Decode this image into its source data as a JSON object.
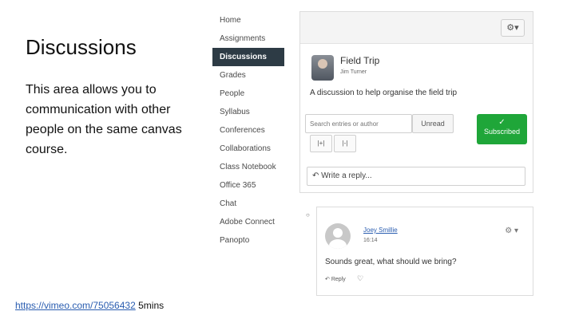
{
  "slide": {
    "title": "Discussions",
    "body": "This area allows you to communication with other people on the same canvas course.",
    "link_text": "https://vimeo.com/75056432",
    "duration": "5mins"
  },
  "nav": {
    "items": [
      {
        "label": "Home"
      },
      {
        "label": "Assignments"
      },
      {
        "label": "Discussions",
        "active": true
      },
      {
        "label": "Grades"
      },
      {
        "label": "People"
      },
      {
        "label": "Syllabus"
      },
      {
        "label": "Conferences"
      },
      {
        "label": "Collaborations"
      },
      {
        "label": "Class Notebook"
      },
      {
        "label": "Office 365"
      },
      {
        "label": "Chat"
      },
      {
        "label": "Adobe Connect"
      },
      {
        "label": "Panopto"
      }
    ]
  },
  "discussion": {
    "settings_icon": "gear-icon",
    "title": "Field Trip",
    "author": "Jim Turner",
    "description": "A discussion to help organise the field trip",
    "search_placeholder": "Search entries or author",
    "unread_label": "Unread",
    "expand_label": "|+|",
    "collapse_label": "|-|",
    "subscribed_label": "Subscribed",
    "reply_placeholder": "Write a reply..."
  },
  "entry": {
    "author": "Joey Smillie",
    "time": "16:14",
    "text": "Sounds great, what should we bring?",
    "reply_label": "Reply"
  },
  "colors": {
    "nav_active": "#2d3b45",
    "subscribed": "#1fa639",
    "link": "#2a5db0"
  }
}
